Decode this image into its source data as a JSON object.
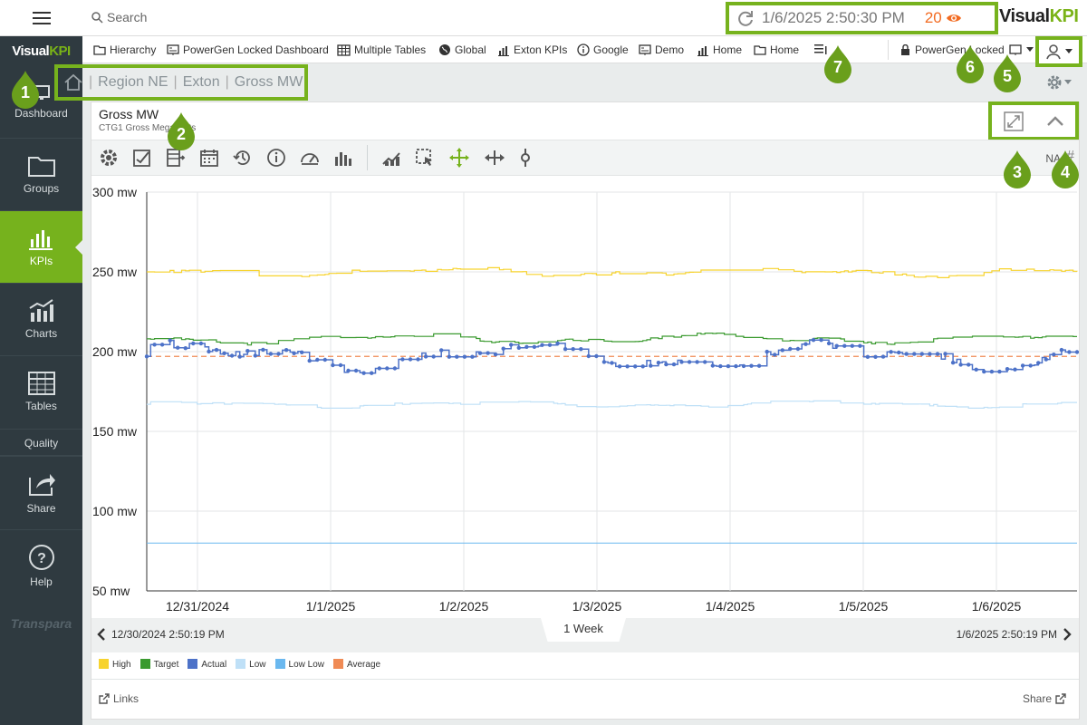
{
  "sidebar": {
    "logo": {
      "part1": "Visual",
      "part2": "KPI"
    },
    "items": [
      {
        "label": "Dashboard",
        "icon": "monitor-icon"
      },
      {
        "label": "Groups",
        "icon": "folder-icon"
      },
      {
        "label": "KPIs",
        "icon": "bar-chart-icon"
      },
      {
        "label": "Charts",
        "icon": "trend-chart-icon"
      },
      {
        "label": "Tables",
        "icon": "table-icon"
      },
      {
        "label": "Quality",
        "icon": ""
      },
      {
        "label": "Share",
        "icon": "share-icon"
      },
      {
        "label": "Help",
        "icon": "help-icon"
      }
    ],
    "brand": "Transpara"
  },
  "topbar": {
    "search_placeholder": "Search",
    "timestamp": "1/6/2025 2:50:30 PM",
    "count": "20",
    "brand_part1": "Visual",
    "brand_part2": "KPI"
  },
  "navbar": {
    "items": [
      {
        "label": "Hierarchy",
        "icon": "folder-icon"
      },
      {
        "label": "PowerGen Locked Dashboard",
        "icon": "dashboard-icon"
      },
      {
        "label": "Multiple Tables",
        "icon": "table-icon"
      },
      {
        "label": "Global",
        "icon": "globe-icon"
      },
      {
        "label": "Exton KPIs",
        "icon": "bar-chart-icon"
      },
      {
        "label": "Google",
        "icon": "info-icon"
      },
      {
        "label": "Demo",
        "icon": "dashboard-icon"
      },
      {
        "label": "Home",
        "icon": "bar-chart-icon"
      },
      {
        "label": "Home",
        "icon": "folder-icon"
      }
    ],
    "locked_label": "PowerGen Locked"
  },
  "breadcrumb": {
    "items": [
      "Region NE",
      "Exton",
      "Gross MW"
    ]
  },
  "panel": {
    "title": "Gross MW",
    "subtitle": "CTG1 Gross Megawatts",
    "toolbar_right": "NA",
    "toolbar_hash": "#"
  },
  "range": {
    "start": "12/30/2024 2:50:19 PM",
    "end": "1/6/2025 2:50:19 PM",
    "period": "1 Week"
  },
  "footer": {
    "links": "Links",
    "share": "Share"
  },
  "callouts": [
    "1",
    "2",
    "3",
    "4",
    "5",
    "6",
    "7"
  ],
  "colors": {
    "accent": "#76b21d",
    "sidebar": "#2f3a40",
    "high": "#f7d32e",
    "target": "#3a9a2f",
    "actual": "#4d72c8",
    "low": "#bfe0f7",
    "lowlow": "#6ab8ef",
    "average": "#f08b55"
  },
  "chart_data": {
    "type": "line",
    "ylim": [
      50,
      300
    ],
    "yticks": [
      "300 mw",
      "250 mw",
      "200 mw",
      "150 mw",
      "100 mw",
      "50 mw"
    ],
    "ytick_values": [
      300,
      250,
      200,
      150,
      100,
      50
    ],
    "xticks": [
      "12/31/2024",
      "1/1/2025",
      "1/2/2025",
      "1/3/2025",
      "1/4/2025",
      "1/5/2025",
      "1/6/2025"
    ],
    "series": [
      {
        "name": "High",
        "color": "#f7d32e",
        "base": 250,
        "amp": 2
      },
      {
        "name": "Target",
        "color": "#3a9a2f",
        "base": 208,
        "amp": 2
      },
      {
        "name": "Actual",
        "color": "#4d72c8",
        "base": 197,
        "amp": 6
      },
      {
        "name": "Low",
        "color": "#bfe0f7",
        "base": 167,
        "amp": 1.5
      },
      {
        "name": "Low Low",
        "color": "#6ab8ef",
        "base": 80,
        "amp": 0
      },
      {
        "name": "Average",
        "color": "#f08b55",
        "base": 197,
        "amp": 0
      }
    ]
  }
}
